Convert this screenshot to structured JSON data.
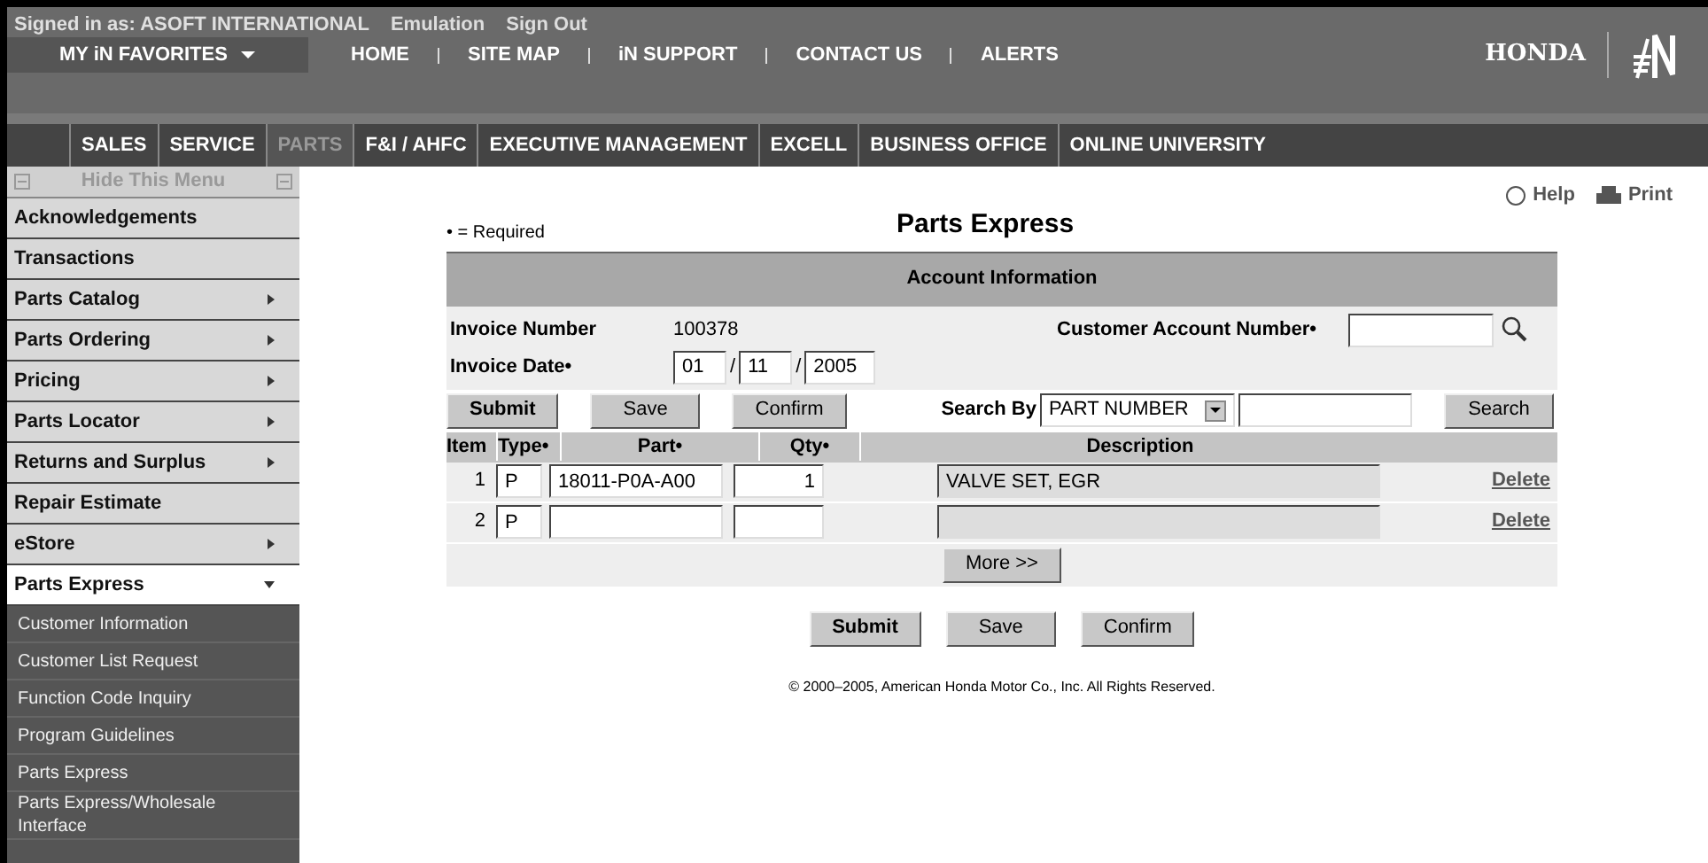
{
  "header": {
    "signed_in": "Signed in as: ASOFT INTERNATIONAL",
    "links": [
      "Emulation",
      "Sign Out"
    ],
    "favorites": "MY iN FAVORITES",
    "nav": [
      "HOME",
      "SITE MAP",
      "iN SUPPORT",
      "CONTACT US",
      "ALERTS"
    ],
    "brand": "HONDA"
  },
  "tabs": [
    {
      "label": "SALES",
      "selected": false
    },
    {
      "label": "SERVICE",
      "selected": false
    },
    {
      "label": "PARTS",
      "selected": true
    },
    {
      "label": "F&I / AHFC",
      "selected": false
    },
    {
      "label": "EXECUTIVE MANAGEMENT",
      "selected": false
    },
    {
      "label": "EXCELL",
      "selected": false
    },
    {
      "label": "BUSINESS OFFICE",
      "selected": false
    },
    {
      "label": "ONLINE UNIVERSITY",
      "selected": false
    }
  ],
  "sidebar": {
    "hide_label": "Hide This Menu",
    "items": [
      {
        "label": "Acknowledgements",
        "submenu": false,
        "expanded": false
      },
      {
        "label": "Transactions",
        "submenu": false,
        "expanded": false
      },
      {
        "label": "Parts Catalog",
        "submenu": true,
        "expanded": false
      },
      {
        "label": "Parts Ordering",
        "submenu": true,
        "expanded": false
      },
      {
        "label": "Pricing",
        "submenu": true,
        "expanded": false
      },
      {
        "label": "Parts Locator",
        "submenu": true,
        "expanded": false
      },
      {
        "label": "Returns and Surplus",
        "submenu": true,
        "expanded": false
      },
      {
        "label": "Repair Estimate",
        "submenu": false,
        "expanded": false
      },
      {
        "label": "eStore",
        "submenu": true,
        "expanded": false
      },
      {
        "label": "Parts Express",
        "submenu": true,
        "expanded": true,
        "children": [
          {
            "label": "Customer Information"
          },
          {
            "label": "Customer List Request"
          },
          {
            "label": "Function Code Inquiry"
          },
          {
            "label": "Program Guidelines"
          },
          {
            "label": "Parts Express"
          },
          {
            "label": "Parts Express/Wholesale Interface"
          }
        ]
      }
    ]
  },
  "tools": [
    "Help",
    "Print"
  ],
  "required_note": "• = Required",
  "title": "Parts Express",
  "section": "Account Information",
  "invoice_number_label": "Invoice Number",
  "invoice_number": "100378",
  "account_label": "Customer Account Number•",
  "invoice_date_label": "Invoice Date•",
  "invoice_date": [
    "01",
    "11",
    "2005"
  ],
  "date_sep": "/",
  "buttons": [
    "Submit",
    "Save",
    "Confirm"
  ],
  "search_by_label": "Search By",
  "search_by": "PART NUMBER",
  "search_button": "Search",
  "columns": [
    "Item",
    "Type•",
    "Part•",
    "Qty•",
    "Description"
  ],
  "rows": [
    {
      "item": "1",
      "type": "P",
      "part": "18011-P0A-A00",
      "qty": "1",
      "description": "VALVE SET, EGR",
      "action": "Delete"
    },
    {
      "item": "2",
      "type": "P",
      "part": "",
      "qty": "",
      "description": "",
      "action": "Delete"
    }
  ],
  "more_button": "More >>",
  "bottom_buttons": [
    "Submit",
    "Save",
    "Confirm"
  ],
  "copyright": "© 2000–2005, American Honda Motor Co., Inc. All Rights Reserved."
}
